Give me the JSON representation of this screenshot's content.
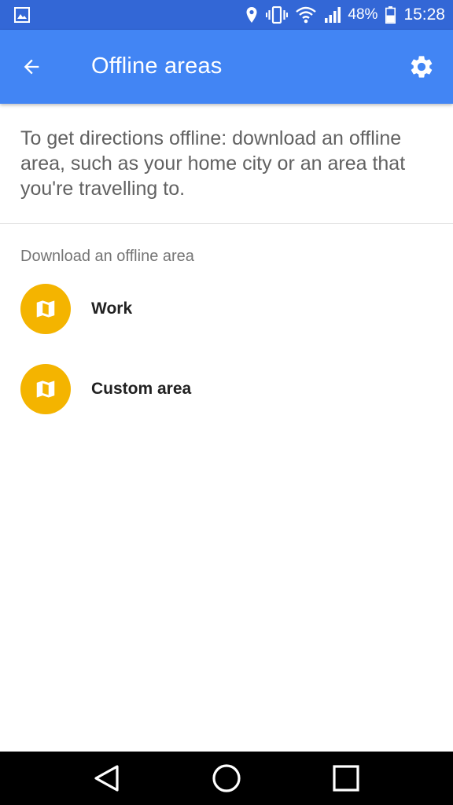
{
  "status_bar": {
    "battery_percent": "48%",
    "time": "15:28",
    "icons": [
      "gallery-icon",
      "location-icon",
      "vibrate-icon",
      "wifi-icon",
      "signal-icon",
      "battery-icon"
    ]
  },
  "app_bar": {
    "title": "Offline areas",
    "back_icon": "arrow-back-icon",
    "settings_icon": "gear-icon"
  },
  "main": {
    "intro_text": "To get directions offline: download an offline area, such as your home city or an area that you're travelling to.",
    "section_header": "Download an offline area",
    "items": [
      {
        "label": "Work",
        "icon": "map-icon"
      },
      {
        "label": "Custom area",
        "icon": "map-icon"
      }
    ]
  },
  "nav_bar": {
    "icons": [
      "back-triangle-icon",
      "home-circle-icon",
      "recents-square-icon"
    ]
  },
  "colors": {
    "status_bar": "#3367d6",
    "app_bar": "#4285f4",
    "map_icon_bg": "#f4b400",
    "nav_bar": "#000000"
  }
}
